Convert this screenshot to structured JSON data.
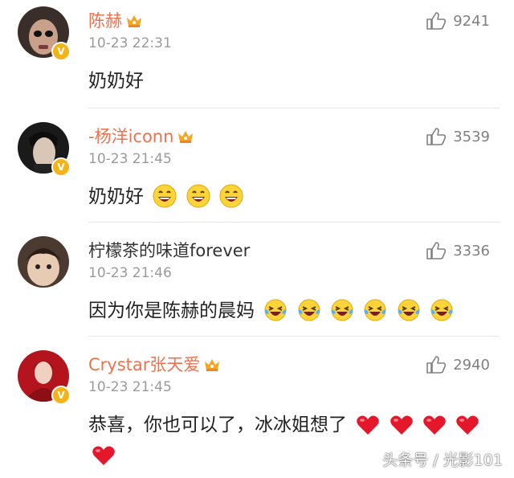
{
  "comments": [
    {
      "name": "陈赫",
      "vip": true,
      "time": "10-23 22:31",
      "text": "奶奶好",
      "emoji": "",
      "emoji_count": 0,
      "likes": "9241",
      "avatar_colors": [
        "#3a2e2a",
        "#c9a08a"
      ]
    },
    {
      "name": "-杨洋iconn",
      "vip": true,
      "time": "10-23 21:45",
      "text": "奶奶好",
      "emoji": "grin-emoji",
      "emoji_count": 3,
      "likes": "3539",
      "avatar_colors": [
        "#1a1a1a",
        "#d8c7b6"
      ]
    },
    {
      "name": "柠檬茶的味道forever",
      "vip": false,
      "time": "10-23 21:46",
      "text": "因为你是陈赫的晨妈",
      "emoji": "laugh-tears-emoji",
      "emoji_count": 6,
      "likes": "3336",
      "avatar_colors": [
        "#4a3a30",
        "#e8cbb3"
      ]
    },
    {
      "name": "Crystar张天爱",
      "vip": true,
      "time": "10-23 21:45",
      "text": "恭喜，你也可以了，冰冰姐想了",
      "emoji": "heart-emoji",
      "emoji_count": 5,
      "likes": "2940",
      "avatar_colors": [
        "#b3141d",
        "#f0d0c0"
      ]
    }
  ],
  "watermark": "头条号 / 光影101",
  "colors": {
    "vip_name": "#eb7350",
    "time": "#9a9a9a",
    "like": "#808080",
    "badge": "#f5b31a",
    "grin_face": "#ffd43b",
    "heart": "#e5172b",
    "divider": "#e6e6e6"
  }
}
